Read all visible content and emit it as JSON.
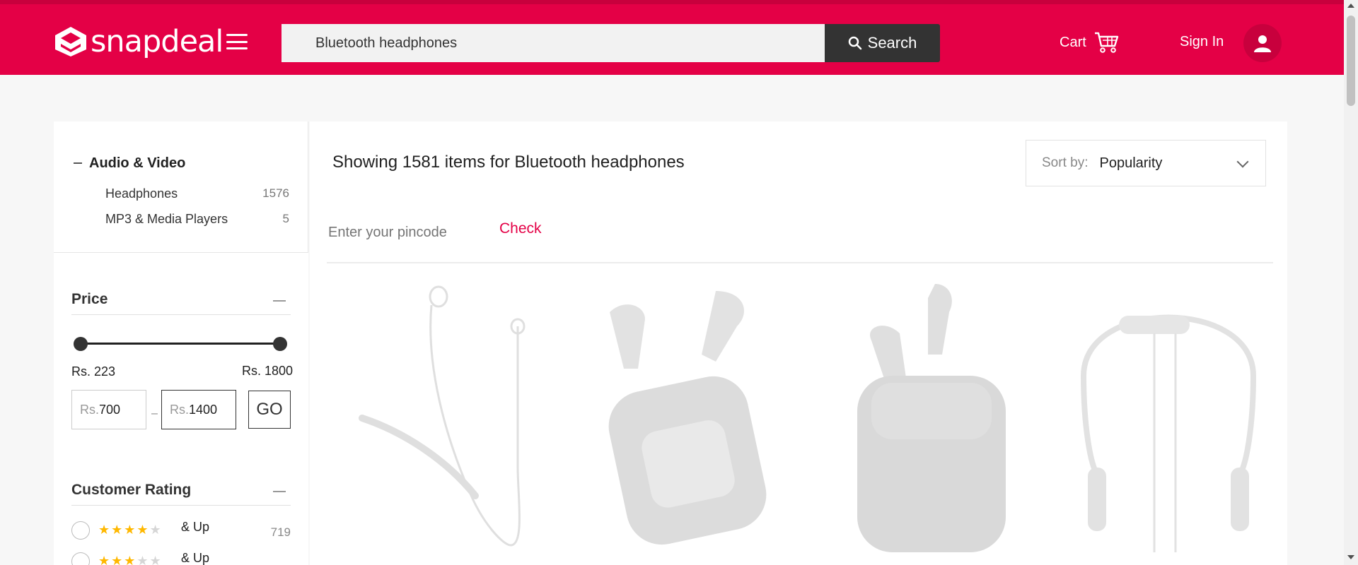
{
  "brand": {
    "name": "snapdeal"
  },
  "search": {
    "value": "Bluetooth headphones",
    "button_label": "Search"
  },
  "header": {
    "cart_label": "Cart",
    "signin_label": "Sign In"
  },
  "categories": {
    "title": "Audio & Video",
    "items": [
      {
        "label": "Headphones",
        "count": "1576"
      },
      {
        "label": "MP3 & Media Players",
        "count": "5"
      }
    ]
  },
  "price_filter": {
    "title": "Price",
    "min_label": "Rs. 223",
    "max_label": "Rs. 1800",
    "prefix": "Rs.",
    "from_value": "700",
    "to_value": "1400",
    "go_label": "GO"
  },
  "rating_filter": {
    "title": "Customer Rating",
    "rows": [
      {
        "stars_on": "★★★★",
        "stars_off": "★",
        "label": "& Up",
        "count": "719"
      },
      {
        "stars_on": "★★★",
        "stars_off": "★★",
        "label": "& Up",
        "count": ""
      }
    ]
  },
  "results": {
    "showing_text": "Showing 1581 items for Bluetooth headphones",
    "sort_label": "Sort by:",
    "sort_value": "Popularity",
    "pincode_placeholder": "Enter your pincode",
    "check_label": "Check"
  },
  "colors": {
    "brand": "#e40046",
    "dark": "#333333",
    "star": "#ffb800"
  }
}
